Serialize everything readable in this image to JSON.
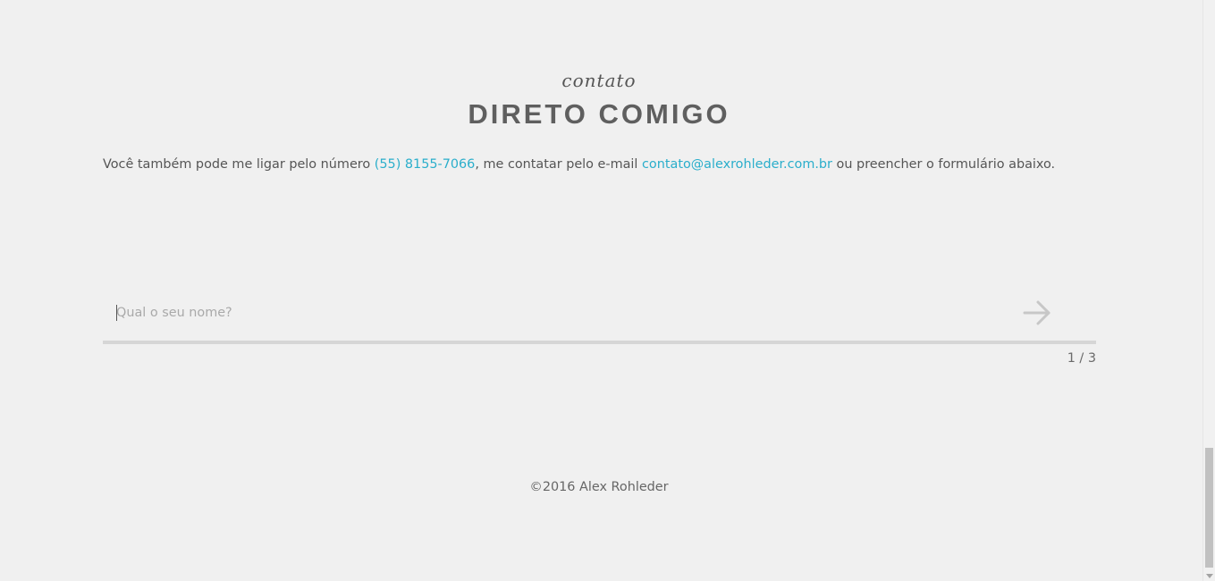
{
  "section": {
    "kicker": "contato",
    "title": "DIRETO COMIGO"
  },
  "intro": {
    "text_before_phone": "Você também pode me ligar pelo número ",
    "phone": "(55) 8155-7066",
    "text_before_email": ", me contatar pelo e-mail ",
    "email": "contato@alexrohleder.com.br",
    "text_after_email": " ou preencher o formulário abaixo."
  },
  "form": {
    "name_input": {
      "value": "",
      "placeholder": "Qual o seu nome?"
    },
    "next_icon": "arrow-right-icon",
    "step_counter": "1 / 3",
    "progress": 0
  },
  "footer": {
    "copyright": "©2016 Alex Rohleder"
  },
  "colors": {
    "background": "#f0f0f0",
    "link": "#2aaecb",
    "title": "#5f5f5f",
    "text": "#555555",
    "track": "#d6d6d6",
    "arrow": "#c7c7c7"
  }
}
